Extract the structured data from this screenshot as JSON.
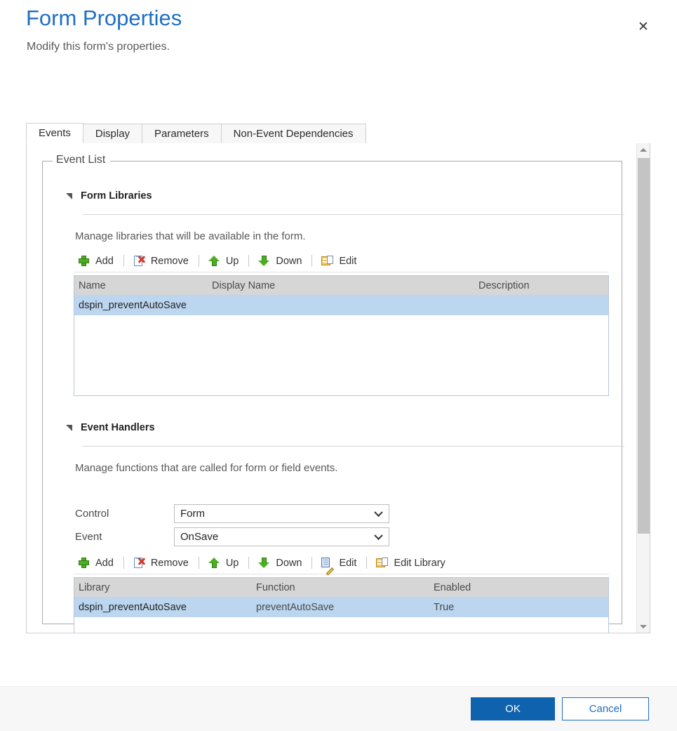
{
  "dialog": {
    "title": "Form Properties",
    "subtitle": "Modify this form's properties.",
    "close_label": "✕"
  },
  "tabs": [
    {
      "label": "Events",
      "active": true
    },
    {
      "label": "Display",
      "active": false
    },
    {
      "label": "Parameters",
      "active": false
    },
    {
      "label": "Non-Event Dependencies",
      "active": false
    }
  ],
  "event_list": {
    "legend": "Event List",
    "form_libraries": {
      "title": "Form Libraries",
      "description": "Manage libraries that will be available in the form.",
      "toolbar": [
        {
          "label": "Add",
          "icon": "plus-icon"
        },
        {
          "label": "Remove",
          "icon": "remove-page-icon"
        },
        {
          "label": "Up",
          "icon": "arrow-up-icon"
        },
        {
          "label": "Down",
          "icon": "arrow-down-icon"
        },
        {
          "label": "Edit",
          "icon": "folder-page-icon"
        }
      ],
      "grid": {
        "columns": [
          "Name",
          "Display Name",
          "Description"
        ],
        "rows": [
          {
            "name": "dspin_preventAutoSave",
            "display_name": "",
            "description": "",
            "selected": true
          }
        ]
      }
    },
    "event_handlers": {
      "title": "Event Handlers",
      "description": "Manage functions that are called for form or field events.",
      "fields": [
        {
          "label": "Control",
          "value": "Form"
        },
        {
          "label": "Event",
          "value": "OnSave"
        }
      ],
      "toolbar": [
        {
          "label": "Add",
          "icon": "plus-icon"
        },
        {
          "label": "Remove",
          "icon": "remove-page-icon"
        },
        {
          "label": "Up",
          "icon": "arrow-up-icon"
        },
        {
          "label": "Down",
          "icon": "arrow-down-icon"
        },
        {
          "label": "Edit",
          "icon": "edit-pencil-icon"
        },
        {
          "label": "Edit Library",
          "icon": "folder-page-icon"
        }
      ],
      "grid": {
        "columns": [
          "Library",
          "Function",
          "Enabled"
        ],
        "rows": [
          {
            "library": "dspin_preventAutoSave",
            "function": "preventAutoSave",
            "enabled": "True",
            "selected": true
          }
        ]
      }
    }
  },
  "footer": {
    "ok_label": "OK",
    "cancel_label": "Cancel"
  },
  "colors": {
    "title_blue": "#1f6fc4",
    "primary_button": "#0f62ad",
    "selection_blue": "#bcd6f0",
    "grid_header_gray": "#d6d6d6"
  }
}
